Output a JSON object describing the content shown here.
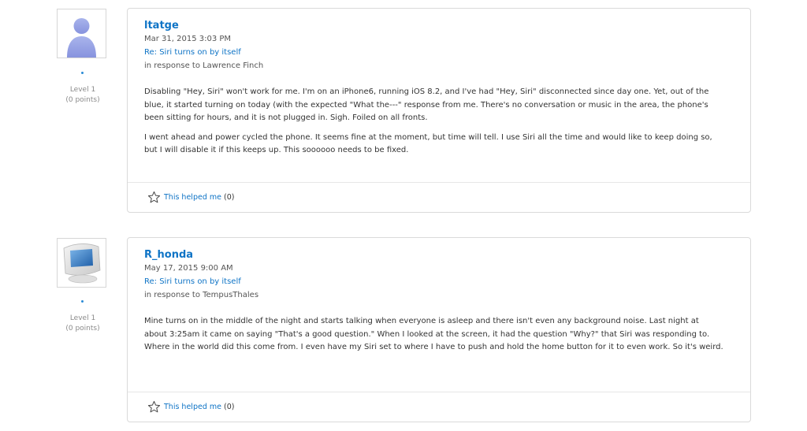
{
  "posts": [
    {
      "username": "ltatge",
      "date": "Mar 31, 2015 3:03 PM",
      "subject": "Re: Siri turns on by itself",
      "in_response": "in response to Lawrence Finch",
      "level": "Level 1",
      "points": "(0 points)",
      "avatar_icon": "default-user-avatar-icon",
      "paragraphs": [
        "Disabling \"Hey, Siri\" won't work for me. I'm on an iPhone6, running iOS 8.2, and I've had \"Hey, Siri\" disconnected since day one. Yet, out of the blue, it started turning on today (with the expected \"What the---\" response from me. There's no conversation or music in the area, the phone's been sitting for hours, and it is not plugged in. Sigh. Foiled on all fronts.",
        "I went ahead and power cycled the phone. It seems fine at the moment, but time will tell. I use Siri all the time and would like to keep doing so, but I will disable it if this keeps up. This soooooo needs to be fixed."
      ],
      "helped_label": "This helped me",
      "helped_count": "(0)"
    },
    {
      "username": "R_honda",
      "date": "May 17, 2015 9:00 AM",
      "subject": "Re: Siri turns on by itself",
      "in_response": "in response to TempusThales",
      "level": "Level 1",
      "points": "(0 points)",
      "avatar_icon": "emac-avatar-icon",
      "paragraphs": [
        "Mine turns on in the middle of the night and starts talking when everyone is asleep and there isn't even any background noise. Last night at about 3:25am it came on saying \"That's a good question.\" When I looked at the screen, it had the question \"Why?\" that Siri was responding to.  Where in the world did this come from.  I even have my Siri set to where I have to push and hold the home button for it to even work. So it's weird."
      ],
      "helped_label": "This helped me",
      "helped_count": "(0)"
    }
  ],
  "colors": {
    "link": "#0f74c6",
    "status_dot": "#2a8bd6",
    "border": "#dadada"
  }
}
